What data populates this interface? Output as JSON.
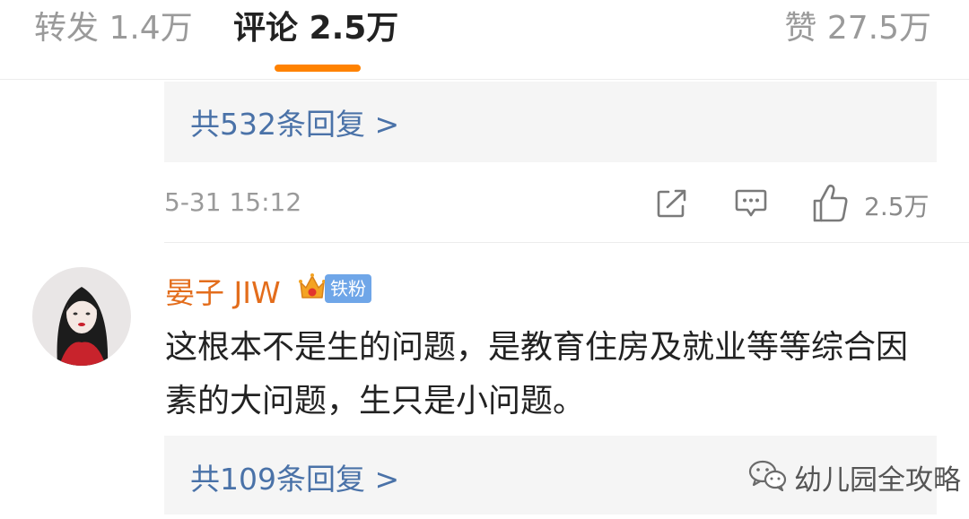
{
  "tabs": {
    "repost": "转发 1.4万",
    "comments": "评论 2.5万",
    "likes": "赞 27.5万",
    "active_color": "#ff8200"
  },
  "comments": [
    {
      "reply_summary": "共532条回复 >",
      "timestamp": "5-31 15:12",
      "like_count": "2.5万",
      "actions": [
        "share-icon",
        "comment-icon",
        "like-icon"
      ]
    },
    {
      "author": "晏子 JIW",
      "badge": "铁粉",
      "badge_icon": "crown-icon",
      "text": "这根本不是生的问题，是教育住房及就业等等综合因素的大问题，生只是小问题。",
      "reply_summary": "共109条回复 >"
    }
  ],
  "watermark": {
    "icon": "wechat-icon",
    "text": "幼儿园全攻略"
  },
  "colors": {
    "link": "#4a72a8",
    "author": "#e36d1c",
    "badge": "#6fa6e8",
    "reply_box_bg": "#f5f5f5"
  }
}
